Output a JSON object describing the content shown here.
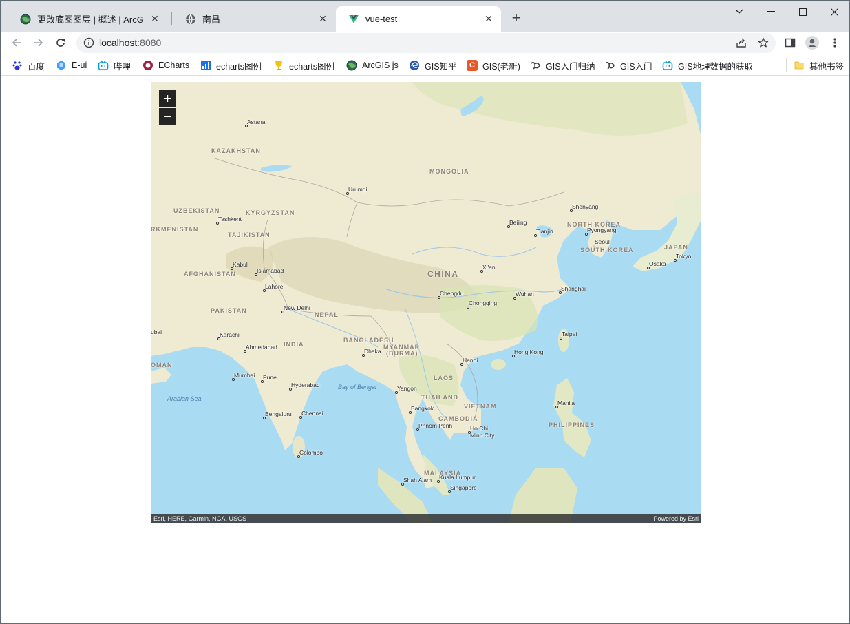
{
  "tabs": [
    {
      "title": "更改底图图层 | 概述 | ArcGIS AP",
      "icon": "globe-arcgis-icon",
      "active": false
    },
    {
      "title": "南昌",
      "icon": "globe-icon",
      "active": false
    },
    {
      "title": "vue-test",
      "icon": "vue-logo-icon",
      "active": true
    }
  ],
  "address": {
    "host": "localhost",
    "port": ":8080"
  },
  "bookmarks": [
    {
      "label": "百度",
      "icon": "baidu-paw-icon"
    },
    {
      "label": "E-ui",
      "icon": "element-ui-icon"
    },
    {
      "label": "哔哩",
      "icon": "bilibili-icon"
    },
    {
      "label": "ECharts",
      "icon": "echarts-icon"
    },
    {
      "label": "echarts图例",
      "icon": "chart-icon"
    },
    {
      "label": "echarts图例",
      "icon": "trophy-icon"
    },
    {
      "label": "ArcGIS js",
      "icon": "globe-arcgis-icon"
    },
    {
      "label": "GIS知乎",
      "icon": "edge-icon"
    },
    {
      "label": "GIS(老新)",
      "icon": "csdn-icon"
    },
    {
      "label": "GIS入门归纳",
      "icon": "yuque-icon"
    },
    {
      "label": "GIS入门",
      "icon": "yuque-icon"
    },
    {
      "label": "GIS地理数据的获取",
      "icon": "bilibili-icon"
    },
    {
      "label": "其他书签",
      "icon": "folder-icon"
    }
  ],
  "map": {
    "zoom_in": "+",
    "zoom_out": "−",
    "attribution_left": "Esri, HERE, Garmin, NGA, USGS",
    "attribution_right": "Powered by Esri",
    "countries": [
      "KAZAKHSTAN",
      "MONGOLIA",
      "UZBEKISTAN",
      "KYRGYZSTAN",
      "RKMENISTAN",
      "TAJIKISTAN",
      "AFGHANISTAN",
      "PAKISTAN",
      "NEPAL",
      "CHINA",
      "INDIA",
      "BANGLADESH",
      "MYANMAR",
      "(BURMA)",
      "LAOS",
      "THAILAND",
      "VIETNAM",
      "CAMBODIA",
      "PHILIPPINES",
      "MALAYSIA",
      "NORTH KOREA",
      "SOUTH KOREA",
      "JAPAN",
      "OMAN"
    ],
    "cities": [
      "Astana",
      "Urumqi",
      "Tashkent",
      "Kabul",
      "Islamabad",
      "Lahore",
      "New Delhi",
      "Karachi",
      "Ahmedabad",
      "Mumbai",
      "Pune",
      "Hyderabad",
      "Bengaluru",
      "Chennai",
      "Colombo",
      "Dhaka",
      "Yangon",
      "Bangkok",
      "Phnom Penh",
      "Ho Chi",
      "Minh City",
      "Hanoi",
      "Kuala Lumpur",
      "Shah Alam",
      "Singapore",
      "Chengdu",
      "Chongqing",
      "Xi'an",
      "Wuhan",
      "Beijing",
      "Tianjin",
      "Shenyang",
      "Pyongyang",
      "Seoul",
      "Shanghai",
      "Taipei",
      "Hong Kong",
      "Manila",
      "Osaka",
      "Tokyo",
      "ubai"
    ],
    "waters": [
      "Bay of Bengal",
      "Arabian Sea"
    ]
  }
}
